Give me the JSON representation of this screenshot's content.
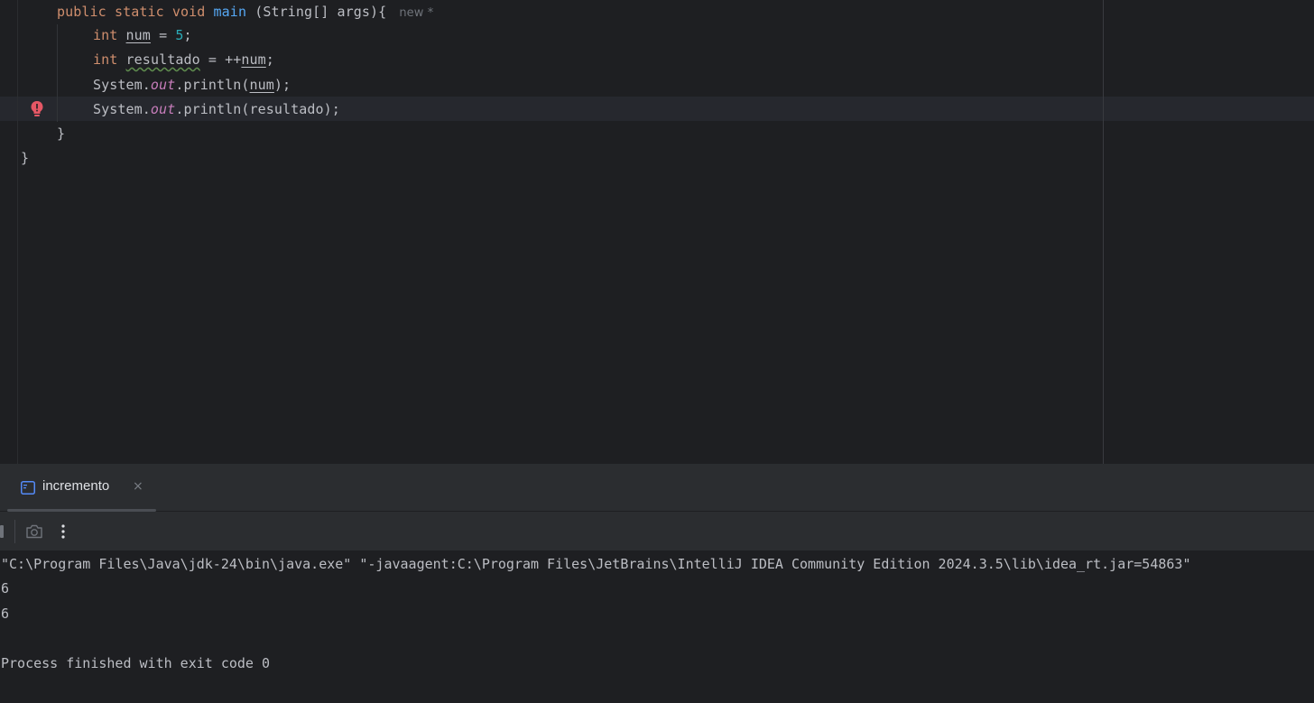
{
  "editor": {
    "lines": {
      "l1": {
        "kw1": "public",
        "kw2": "static",
        "kw3": "void",
        "method": "main",
        "rest": " (String[] args){",
        "hint": "new *"
      },
      "l2": {
        "kw": "int",
        "var": "num",
        "mid": " = ",
        "num": "5",
        "end": ";"
      },
      "l3": {
        "kw": "int",
        "var": "resultado",
        "mid": " = ++",
        "var2": "num",
        "end": ";"
      },
      "l4": {
        "pre": "System.",
        "field": "out",
        "mid": ".println(",
        "arg": "num",
        "end": ");"
      },
      "l5": {
        "pre": "System.",
        "field": "out",
        "mid": ".println(resultado);"
      },
      "l6": {
        "text": "}"
      },
      "l7": {
        "text": "}"
      }
    },
    "gutter_icon": "red-bulb-icon"
  },
  "run_window": {
    "tab_label": "incremento",
    "tab_close": "×",
    "toolbar": {
      "screenshot_icon": "camera-icon",
      "more_icon": "more-vertical-icon"
    },
    "console": {
      "command": "\"C:\\Program Files\\Java\\jdk-24\\bin\\java.exe\" \"-javaagent:C:\\Program Files\\JetBrains\\IntelliJ IDEA Community Edition 2024.3.5\\lib\\idea_rt.jar=54863\"",
      "out1": "6",
      "out2": "6",
      "blank": "",
      "finish": "Process finished with exit code 0"
    }
  },
  "colors": {
    "background": "#1e1f22",
    "keyword": "#cf8e6d",
    "method": "#56a8f5",
    "number": "#2aacb8",
    "static_field": "#c77dbb",
    "text": "#bcbec4"
  }
}
